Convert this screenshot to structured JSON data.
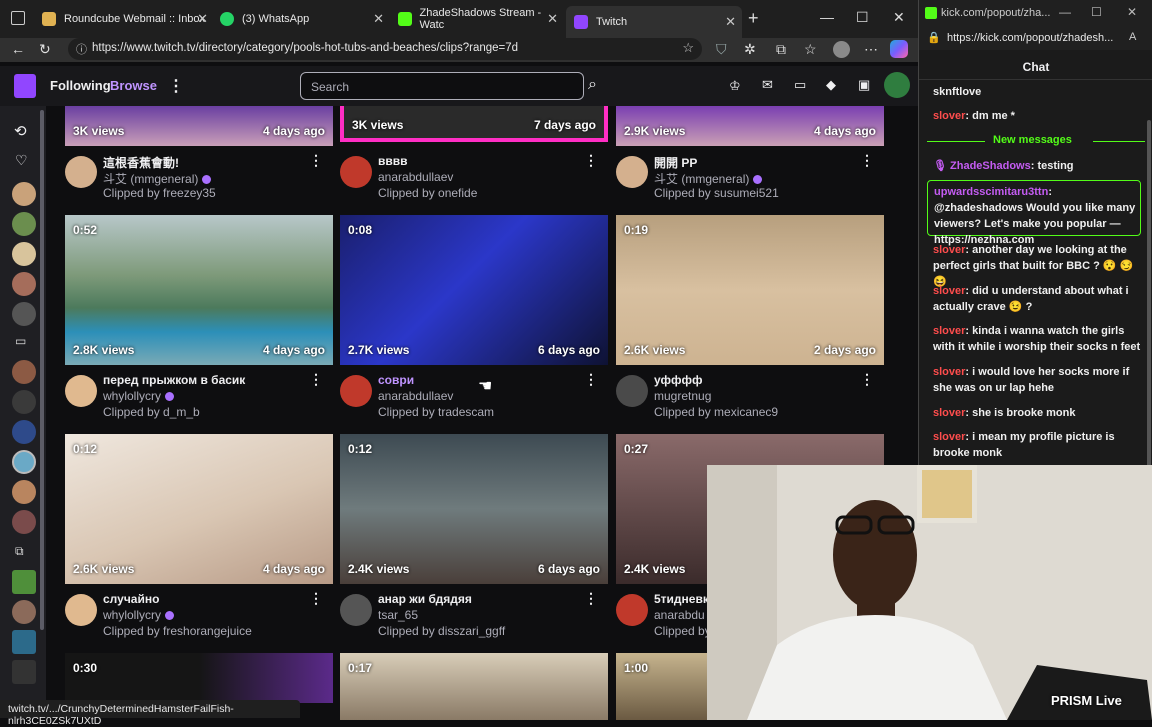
{
  "browser": {
    "tabs": [
      {
        "title": "Roundcube Webmail :: Inbox",
        "color": "#e0b252"
      },
      {
        "title": "(3) WhatsApp",
        "color": "#25d366"
      },
      {
        "title": "ZhadeShadows Stream - Watc",
        "color": "#53fc18"
      },
      {
        "title": "Twitch",
        "color": "#9146ff"
      }
    ],
    "url": "https://www.twitch.tv/directory/category/pools-hot-tubs-and-beaches/clips?range=7d",
    "status_url": "twitch.tv/.../CrunchyDeterminedHamsterFailFish-nlrh3CE0ZSk7UXtD"
  },
  "twitch": {
    "nav": {
      "following": "Following",
      "browse": "Browse"
    },
    "search_placeholder": "Search",
    "accent": "#9146ff",
    "clips": [
      {
        "views": "3K views",
        "ago": "4 days ago",
        "duration": "",
        "title": "這根香蕉會動!",
        "channel": "斗艾 (mmgeneral)",
        "verified": true,
        "clipped_by": "Clipped by freezey35"
      },
      {
        "views": "3K views",
        "ago": "7 days ago",
        "duration": "",
        "title": "вввв",
        "channel": "anarabdullaev",
        "verified": false,
        "clipped_by": "Clipped by onefide"
      },
      {
        "views": "2.9K views",
        "ago": "4 days ago",
        "duration": "",
        "title": "開開 PP",
        "channel": "斗艾 (mmgeneral)",
        "verified": true,
        "clipped_by": "Clipped by susumei521"
      },
      {
        "views": "2.8K views",
        "ago": "4 days ago",
        "duration": "0:52",
        "title": "перед прыжком в басик",
        "channel": "whylollycry",
        "verified": true,
        "clipped_by": "Clipped by d_m_b"
      },
      {
        "views": "2.7K views",
        "ago": "6 days ago",
        "duration": "0:08",
        "title": "соври",
        "channel": "anarabdullaev",
        "verified": false,
        "clipped_by": "Clipped by tradescam"
      },
      {
        "views": "2.6K views",
        "ago": "2 days ago",
        "duration": "0:19",
        "title": "уфффф",
        "channel": "mugretnug",
        "verified": false,
        "clipped_by": "Clipped by mexicanec9"
      },
      {
        "views": "2.6K views",
        "ago": "4 days ago",
        "duration": "0:12",
        "title": "случайно",
        "channel": "whylollycry",
        "verified": true,
        "clipped_by": "Clipped by freshorangejuice"
      },
      {
        "views": "2.4K views",
        "ago": "6 days ago",
        "duration": "0:12",
        "title": "анар жи бдядяя",
        "channel": "tsar_65",
        "verified": false,
        "clipped_by": "Clipped by disszari_ggff"
      },
      {
        "views": "2.4K views",
        "ago": "",
        "duration": "0:27",
        "title": "5тидневк",
        "channel": "anarabdu",
        "verified": false,
        "clipped_by": "Clipped by"
      },
      {
        "views": "",
        "ago": "",
        "duration": "0:30",
        "title": "",
        "channel": "",
        "verified": false,
        "clipped_by": ""
      },
      {
        "views": "",
        "ago": "",
        "duration": "0:17",
        "title": "",
        "channel": "",
        "verified": false,
        "clipped_by": ""
      },
      {
        "views": "",
        "ago": "",
        "duration": "1:00",
        "title": "",
        "channel": "",
        "verified": false,
        "clipped_by": ""
      }
    ]
  },
  "kick": {
    "url": "https://kick.com/popout/zhadesh...",
    "tab_title": "kick.com/popout/zha...",
    "chat_title": "Chat",
    "new_messages": "New messages",
    "accent": "#53fc18",
    "messages": [
      {
        "user": "",
        "text": "sknftlove"
      },
      {
        "user": "slover",
        "text": "dm me *"
      },
      {
        "user": "ZhadeShadows",
        "text": "testing"
      },
      {
        "user": "upwardsscimitaru3ttn",
        "text": "@zhadeshadows Would you like many viewers? Let's make you popular — https://nezhna.com"
      },
      {
        "user": "slover",
        "text": "another day we looking at the perfect girls that built for BBC ? 😯 😏 😆"
      },
      {
        "user": "slover",
        "text": "did u understand about what i actually crave 😉 ?"
      },
      {
        "user": "slover",
        "text": "kinda i wanna watch the girls with it while i worship their socks n feet"
      },
      {
        "user": "slover",
        "text": "i would love her socks more if she was on ur lap hehe"
      },
      {
        "user": "slover",
        "text": "she is brooke monk"
      },
      {
        "user": "slover",
        "text": "i mean my profile picture is brooke monk"
      }
    ]
  },
  "overlay": {
    "prism": "PRISM Live"
  }
}
